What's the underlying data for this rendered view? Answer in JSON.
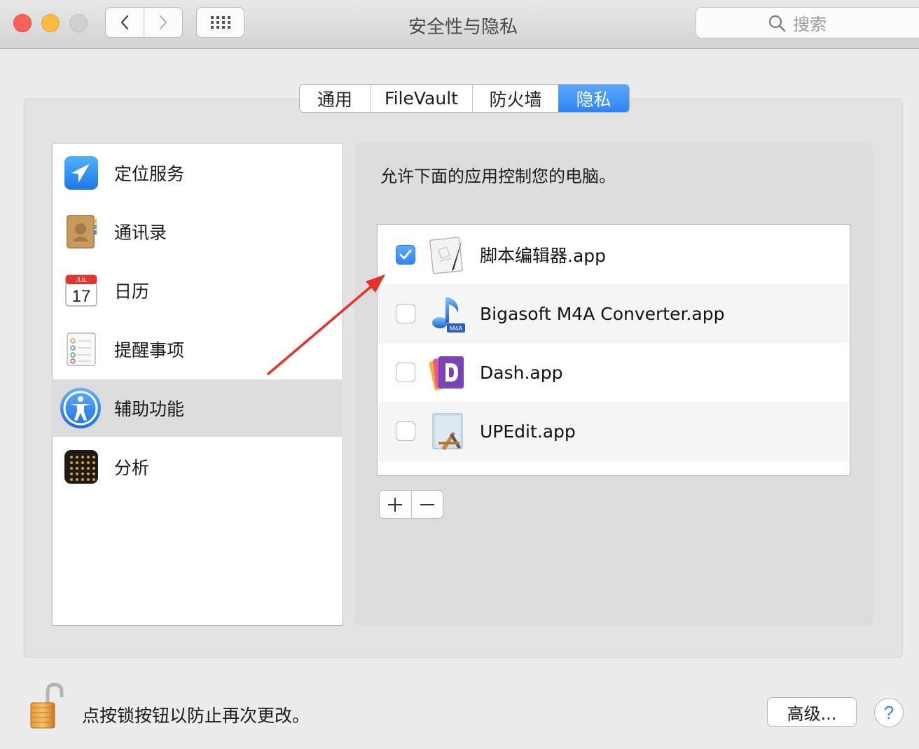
{
  "window": {
    "title": "安全性与隐私",
    "search_placeholder": "搜索"
  },
  "tabs": [
    {
      "label": "通用",
      "active": false
    },
    {
      "label": "FileVault",
      "active": false
    },
    {
      "label": "防火墙",
      "active": false
    },
    {
      "label": "隐私",
      "active": true
    }
  ],
  "categories": [
    {
      "label": "定位服务",
      "icon": "location-services-icon",
      "selected": false
    },
    {
      "label": "通讯录",
      "icon": "contacts-icon",
      "selected": false
    },
    {
      "label": "日历",
      "icon": "calendar-icon",
      "selected": false,
      "icon_month": "JUL",
      "icon_day": "17"
    },
    {
      "label": "提醒事项",
      "icon": "reminders-icon",
      "selected": false
    },
    {
      "label": "辅助功能",
      "icon": "accessibility-icon",
      "selected": true
    },
    {
      "label": "分析",
      "icon": "analytics-icon",
      "selected": false
    }
  ],
  "main": {
    "prompt": "允许下面的应用控制您的电脑。",
    "apps": [
      {
        "name": "脚本编辑器.app",
        "checked": true,
        "icon": "script-editor-icon"
      },
      {
        "name": "Bigasoft M4A Converter.app",
        "checked": false,
        "icon": "m4a-converter-icon",
        "icon_badge": "M4A"
      },
      {
        "name": "Dash.app",
        "checked": false,
        "icon": "dash-icon"
      },
      {
        "name": "UPEdit.app",
        "checked": false,
        "icon": "upedit-icon"
      }
    ]
  },
  "footer": {
    "lock_text": "点按锁按钮以防止再次更改。",
    "advanced_label": "高级...",
    "help_label": "?"
  },
  "colors": {
    "accent": "#2f85f5",
    "annotation_arrow": "#e8312a",
    "window_bg": "#ececec",
    "selected_row": "#dcdcdc"
  }
}
